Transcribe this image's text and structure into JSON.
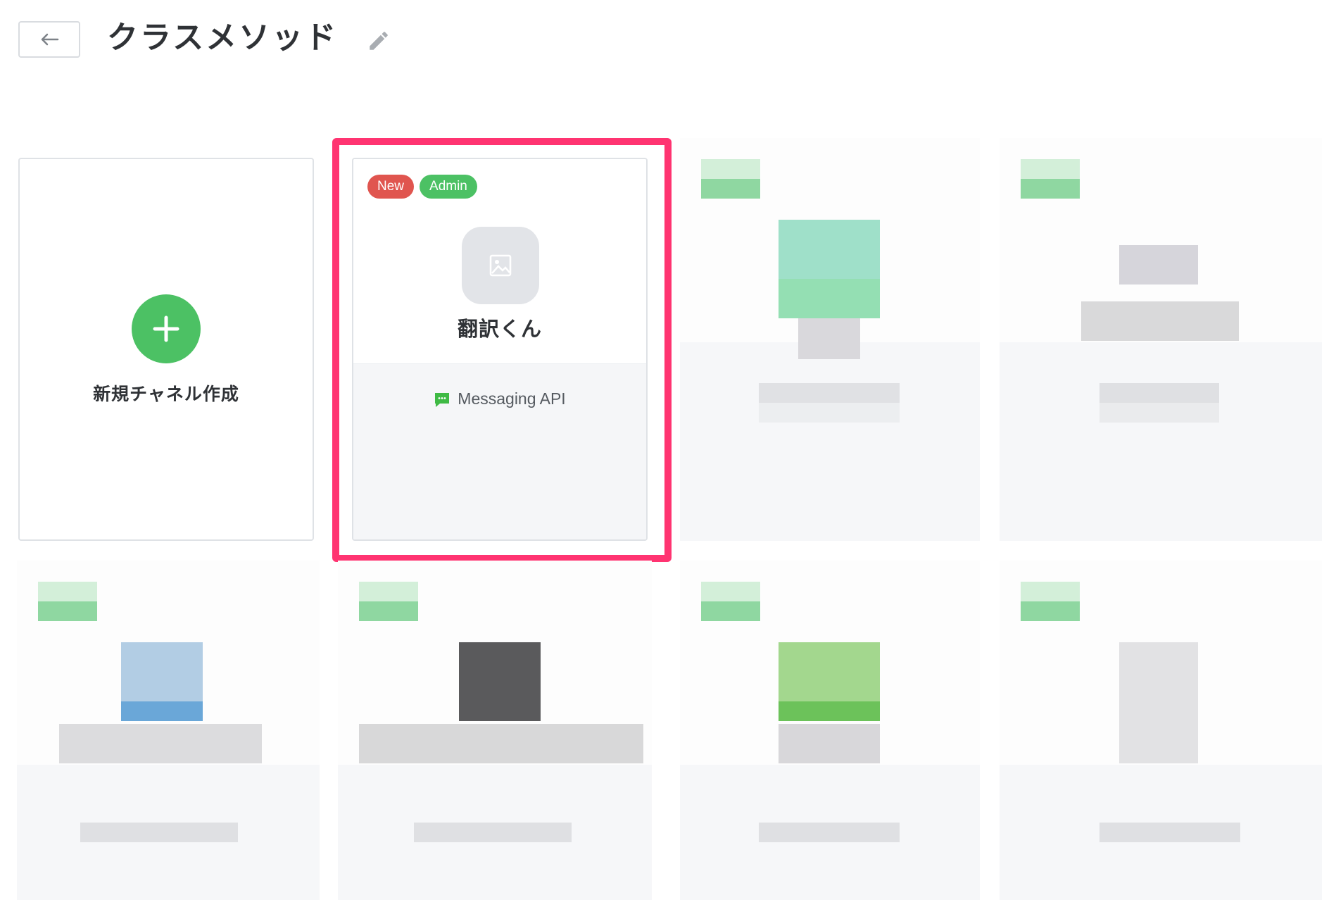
{
  "header": {
    "title": "クラスメソッド"
  },
  "create_card": {
    "label": "新規チャネル作成"
  },
  "channel_card": {
    "badges": [
      "New",
      "Admin"
    ],
    "name": "翻訳くん",
    "type": "Messaging API"
  },
  "colors": {
    "highlight": "#ff3471",
    "green": "#4cc164",
    "new_badge": "#e0554f"
  },
  "icons": [
    "back-arrow-icon",
    "pencil-icon",
    "plus-icon",
    "image-placeholder-icon",
    "chat-bubble-icon"
  ]
}
